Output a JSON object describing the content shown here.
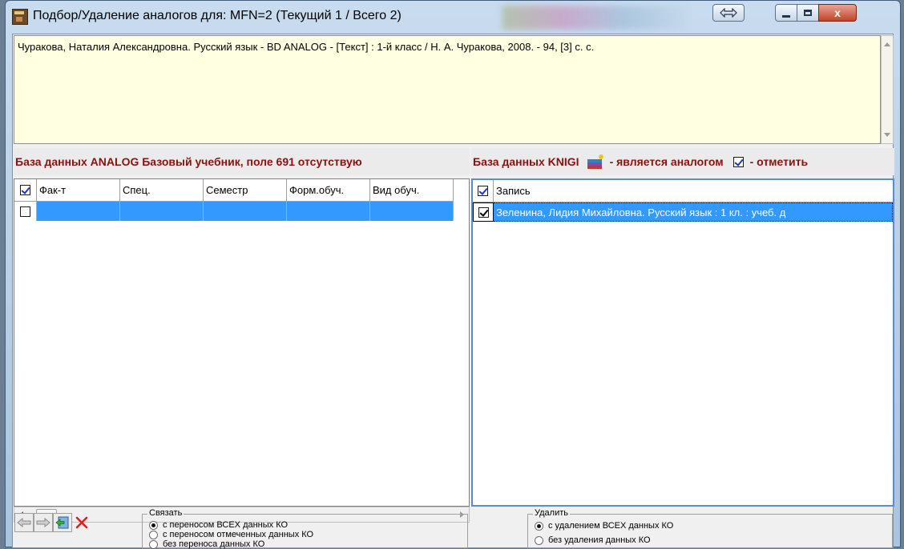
{
  "window": {
    "title": "Подбор/Удаление аналогов для: MFN=2 (Текущий 1 / Всего 2)",
    "close_label": "x"
  },
  "record": {
    "text": "Чуракова, Наталия Александровна. Русский язык - BD ANALOG -  [Текст] : 1-й класс / Н. А. Чуракова, 2008. - 94, [3] с. с."
  },
  "left_panel": {
    "header": "База данных ANALOG   Базовый учебник, поле 691 отсутствую",
    "columns": [
      "Фак-т",
      "Спец.",
      "Семестр",
      "Форм.обуч.",
      "Вид обуч."
    ],
    "header_checked": true,
    "rows": [
      {
        "checked": false,
        "cells": [
          "",
          "",
          "",
          "",
          ""
        ]
      }
    ]
  },
  "right_panel": {
    "db_label": "База данных  KNIGI",
    "is_analog_label": "- является аналогом",
    "mark_label": "- отметить",
    "column": "Запись",
    "header_checked": true,
    "rows": [
      {
        "checked": true,
        "text": "Зеленина, Лидия Михайловна. Русский язык : 1 кл. : учеб. д"
      }
    ]
  },
  "link_group": {
    "legend": "Связать",
    "options": [
      "с переносом ВСЕХ данных КО",
      "с переносом отмеченных данных КО",
      "без переноса данных КО"
    ],
    "selected": 0
  },
  "delete_group": {
    "legend": "Удалить",
    "options": [
      "с удалением ВСЕХ данных КО",
      "без удаления данных КО"
    ],
    "selected": 0
  },
  "toolbar": {
    "icons": [
      "arrow-left-icon",
      "arrow-right-icon",
      "export-icon",
      "delete-icon"
    ]
  }
}
